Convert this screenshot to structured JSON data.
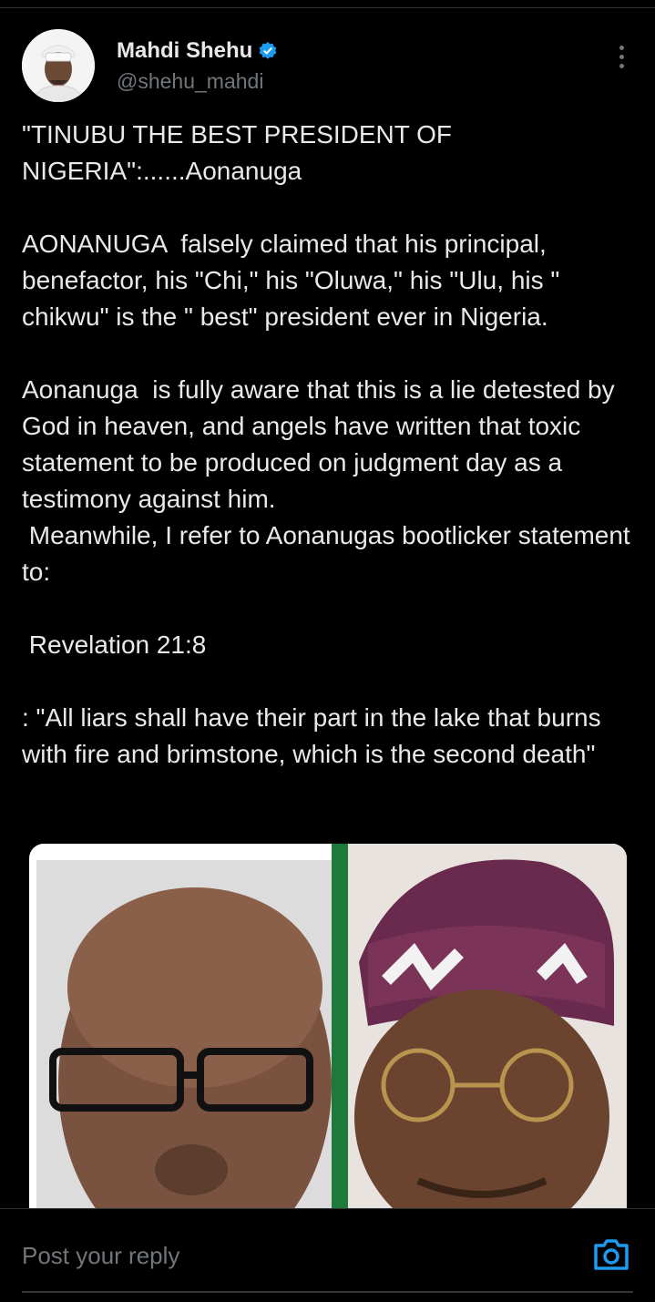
{
  "author": {
    "display_name": "Mahdi Shehu",
    "handle": "@shehu_mahdi",
    "verified": true
  },
  "tweet": {
    "text": "\"TINUBU THE BEST PRESIDENT OF NIGERIA\":......Aonanuga\n\nAONANUGA  falsely claimed that his principal, benefactor, his \"Chi,\" his \"Oluwa,\" his \"Ulu, his \" chikwu\" is the \" best\" president ever in Nigeria.\n\nAonanuga  is fully aware that this is a lie detested by God in heaven, and angels have written that toxic statement to be produced on judgment day as a testimony against him.\n Meanwhile, I refer to Aonanugas bootlicker statement to:\n\n Revelation 21:8\n\n: \"All liars shall have their part in the lake that burns with fire and brimstone, which is the second death\""
  },
  "reply": {
    "placeholder": "Post your reply"
  },
  "colors": {
    "background": "#000000",
    "text": "#e7e9ea",
    "muted": "#71767b",
    "accent": "#1d9bf0"
  },
  "icons": {
    "verified": "verified-badge-icon",
    "more": "more-options-icon",
    "camera": "camera-icon"
  }
}
